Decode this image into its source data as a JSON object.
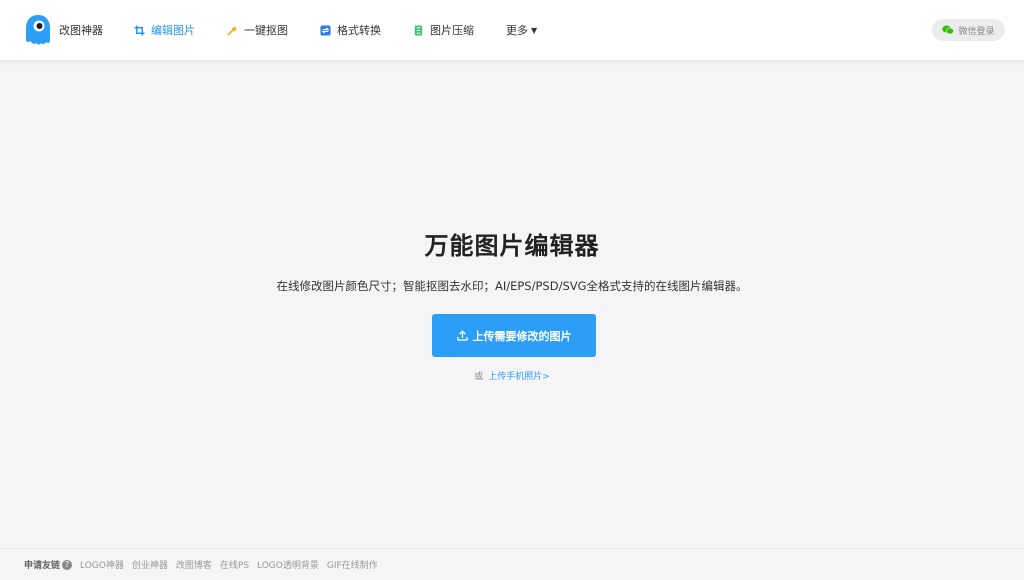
{
  "header": {
    "brand_name": "改图神器",
    "nav": [
      {
        "label": "编辑图片",
        "icon": "crop-icon",
        "active": true
      },
      {
        "label": "一键抠图",
        "icon": "magic-wand-icon",
        "active": false
      },
      {
        "label": "格式转换",
        "icon": "convert-icon",
        "active": false
      },
      {
        "label": "图片压缩",
        "icon": "compress-icon",
        "active": false
      },
      {
        "label": "更多",
        "icon": "caret-down-icon",
        "active": false
      }
    ],
    "login_label": "微信登录"
  },
  "hero": {
    "title": "万能图片编辑器",
    "subtitle": "在线修改图片颜色尺寸；智能抠图去水印；AI/EPS/PSD/SVG全格式支持的在线图片编辑器。",
    "upload_button": "上传需要修改的图片",
    "or_text": "或",
    "mobile_link": "上传手机照片>"
  },
  "footer": {
    "label": "申请友链",
    "help": "?",
    "links": [
      "LOGO神器",
      "创业神器",
      "改图博客",
      "在线PS",
      "LOGO透明背景",
      "GIF在线制作"
    ]
  },
  "colors": {
    "accent": "#2c9ef6",
    "background": "#f5f5f7"
  }
}
